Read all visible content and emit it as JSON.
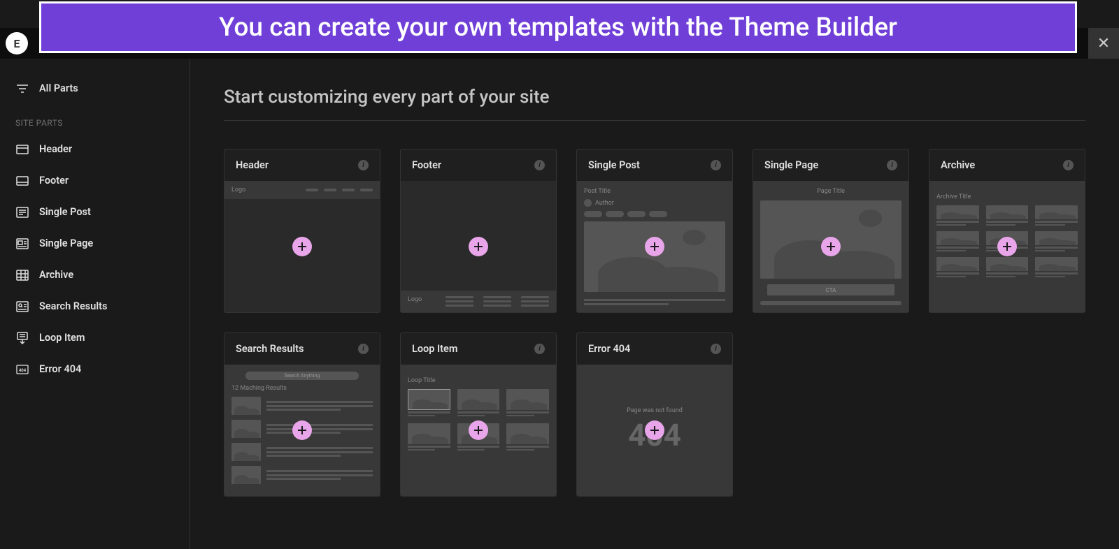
{
  "banner": {
    "text": "You can create your own templates with the Theme Builder"
  },
  "sidebar": {
    "all_parts": "All Parts",
    "section_label": "SITE PARTS",
    "items": [
      {
        "label": "Header",
        "icon": "header-icon"
      },
      {
        "label": "Footer",
        "icon": "footer-icon"
      },
      {
        "label": "Single Post",
        "icon": "single-post-icon"
      },
      {
        "label": "Single Page",
        "icon": "single-page-icon"
      },
      {
        "label": "Archive",
        "icon": "archive-icon"
      },
      {
        "label": "Search Results",
        "icon": "search-results-icon"
      },
      {
        "label": "Loop Item",
        "icon": "loop-item-icon"
      },
      {
        "label": "Error 404",
        "icon": "error-404-icon"
      }
    ]
  },
  "main": {
    "title": "Start customizing every part of your site",
    "cards": [
      {
        "title": "Header",
        "wf_logo": "Logo"
      },
      {
        "title": "Footer",
        "slug": "footer",
        "wf_logo": "Logo"
      },
      {
        "title": "Single Post",
        "slug": "single-post",
        "wf_post_title": "Post Title",
        "wf_author": "Author"
      },
      {
        "title": "Single Page",
        "slug": "single-page",
        "wf_page_title": "Page Title",
        "wf_cta": "CTA"
      },
      {
        "title": "Archive",
        "slug": "archive",
        "wf_archive_title": "Archive Title"
      },
      {
        "title": "Search Results",
        "slug": "search-results",
        "wf_search_placeholder": "Search Anything",
        "wf_results": "12 Maching Results"
      },
      {
        "title": "Loop Item",
        "slug": "loop-item",
        "wf_loop_title": "Loop Title"
      },
      {
        "title": "Error 404",
        "slug": "error-404",
        "wf_not_found": "Page was not found",
        "wf_code": "404"
      }
    ]
  }
}
